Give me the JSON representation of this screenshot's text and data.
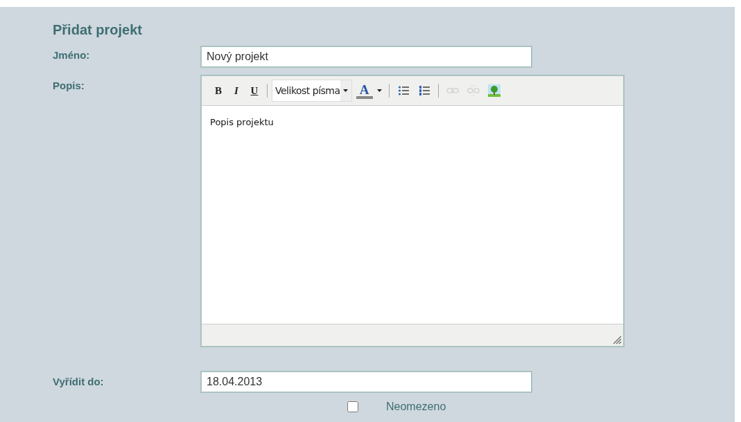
{
  "title": "Přidat projekt",
  "name_field": {
    "label": "Jméno:",
    "value": "Nový projekt"
  },
  "description": {
    "label": "Popis:",
    "toolbar": [
      {
        "kind": "bold",
        "text": "B",
        "disabled": false
      },
      {
        "kind": "italic",
        "text": "I",
        "disabled": false
      },
      {
        "kind": "underline",
        "text": "U",
        "disabled": false
      },
      {
        "kind": "separator"
      },
      {
        "kind": "select",
        "text": "Velikost písma",
        "disabled": false
      },
      {
        "kind": "color",
        "text": "A",
        "disabled": false
      },
      {
        "kind": "separator"
      },
      {
        "kind": "bullets",
        "disabled": false
      },
      {
        "kind": "numbers",
        "disabled": false
      },
      {
        "kind": "separator"
      },
      {
        "kind": "link",
        "disabled": true
      },
      {
        "kind": "unlink",
        "disabled": true
      },
      {
        "kind": "image",
        "disabled": false
      }
    ],
    "content": "Popis projektu"
  },
  "due_field": {
    "label": "Vyřídit do:",
    "value": "18.04.2013"
  },
  "unlimited": {
    "label": "Neomezeno",
    "checked": false
  }
}
